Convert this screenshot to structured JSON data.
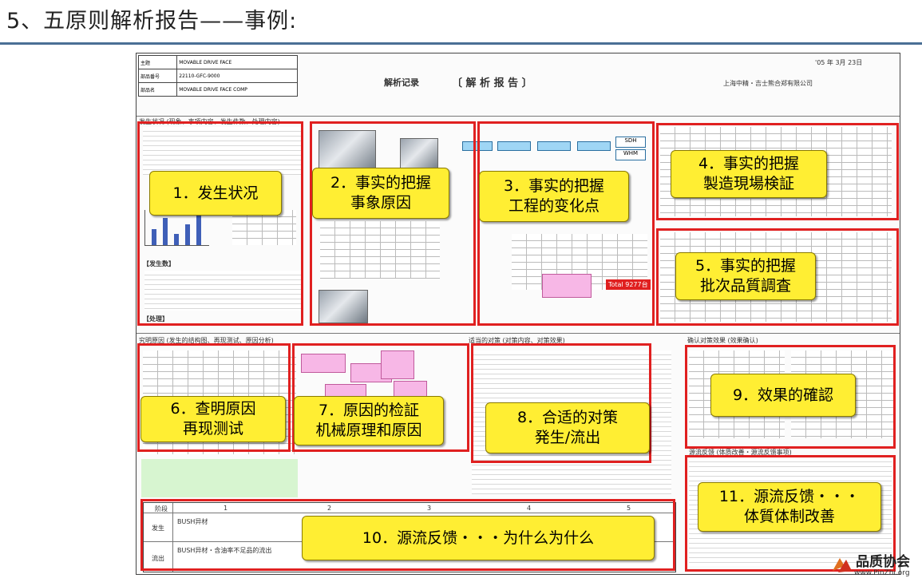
{
  "slide": {
    "title": "5、五原则解析报告——事例:"
  },
  "report": {
    "header": {
      "title_left": "解析记录",
      "title_center": "〔  解 析 报 告  〕",
      "company": "上海中精・吉士熊合郑有限公司",
      "date_label": "'05 年  3月  23日",
      "rows": [
        {
          "label": "主题",
          "value": "MOVABLE DRIVE FACE"
        },
        {
          "label": "部品番号",
          "value": "22110-GFC-9000"
        },
        {
          "label": "部品名",
          "value": "MOVABLE DRIVE FACE COMP"
        }
      ]
    },
    "section_labels": {
      "top": "发生状况 (现象、事项内容、发生件数、处理内容)",
      "mid_left": "究明原因 (发生的结构图、再现测试、原因分析)",
      "mid_center": "适当的对策 (对策内容、对策效果)",
      "mid_right": "确认对策效果 (效果确认)",
      "bottom_right": "源流反馈 (体质改善・源流反馈事项)"
    },
    "table": {
      "header": [
        "阶段",
        "1",
        "2",
        "3",
        "4",
        "5"
      ],
      "rows": [
        {
          "label": "发生",
          "cell": "BUSH异材"
        },
        {
          "label": "流出",
          "cell": "BUSH异材・含油率不足品的流出"
        }
      ]
    },
    "snippets": {
      "total": "Total 9277台",
      "sdh": "SDH",
      "whm": "WHM",
      "occur_count": "【发生数】",
      "handling": "【处理】"
    }
  },
  "callouts": [
    {
      "id": "1",
      "text": "1．发生状况"
    },
    {
      "id": "2",
      "text": "2．事实的把握\n事象原因"
    },
    {
      "id": "3",
      "text": "3．事实的把握\n工程的变化点"
    },
    {
      "id": "4",
      "text": "4．事实的把握\n製造現場検証"
    },
    {
      "id": "5",
      "text": "5．事实的把握\n批次品質調査"
    },
    {
      "id": "6",
      "text": "6．查明原因\n再现测试"
    },
    {
      "id": "7",
      "text": "7．原因的检証\n机械原理和原因"
    },
    {
      "id": "8",
      "text": "8．合适的对策\n発生/流出"
    },
    {
      "id": "9",
      "text": "9．效果的確認"
    },
    {
      "id": "10",
      "text": "10．源流反馈・・・为什么为什么"
    },
    {
      "id": "11",
      "text": "11．源流反馈・・・\n体質体制改善"
    }
  ],
  "watermark": {
    "name": "品质协会",
    "url": "www.PinZhi.org"
  },
  "colors": {
    "accent_rule": "#4a6f95",
    "panel_border": "#e02020",
    "callout_fill": "#ffee33"
  }
}
